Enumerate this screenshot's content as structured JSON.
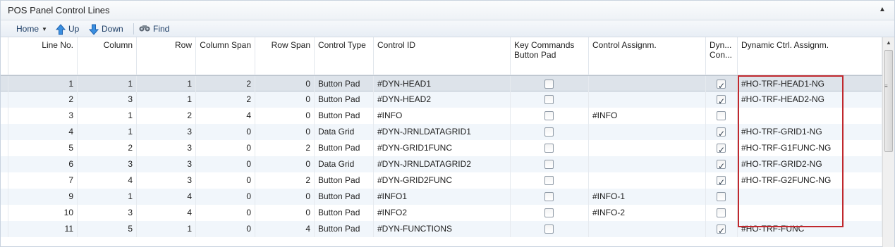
{
  "panel": {
    "title": "POS Panel Control Lines",
    "collapse_icon": "chevron-up-icon"
  },
  "toolbar": {
    "home_label": "Home",
    "up_label": "Up",
    "down_label": "Down",
    "find_label": "Find"
  },
  "columns": [
    {
      "label": "Line No.",
      "align": "right"
    },
    {
      "label": "Column",
      "align": "right"
    },
    {
      "label": "Row",
      "align": "right"
    },
    {
      "label": "Column Span",
      "align": "right"
    },
    {
      "label": "Row Span",
      "align": "right"
    },
    {
      "label": "Control Type",
      "align": "left"
    },
    {
      "label": "Control ID",
      "align": "left"
    },
    {
      "label": "Key Commands Button Pad",
      "align": "left"
    },
    {
      "label": "Control Assignm.",
      "align": "left"
    },
    {
      "label": "Dyn... Con...",
      "align": "left"
    },
    {
      "label": "Dynamic Ctrl. Assignm.",
      "align": "left"
    }
  ],
  "rows": [
    {
      "line": "1",
      "column": "1",
      "row": "1",
      "colspan": "2",
      "rowspan": "0",
      "type": "Button Pad",
      "id": "#DYN-HEAD1",
      "keycmd": false,
      "assign": "",
      "dyn": true,
      "dynassign": "#HO-TRF-HEAD1-NG"
    },
    {
      "line": "2",
      "column": "3",
      "row": "1",
      "colspan": "2",
      "rowspan": "0",
      "type": "Button Pad",
      "id": "#DYN-HEAD2",
      "keycmd": false,
      "assign": "",
      "dyn": true,
      "dynassign": "#HO-TRF-HEAD2-NG"
    },
    {
      "line": "3",
      "column": "1",
      "row": "2",
      "colspan": "4",
      "rowspan": "0",
      "type": "Button Pad",
      "id": "#INFO",
      "keycmd": false,
      "assign": "#INFO",
      "dyn": false,
      "dynassign": ""
    },
    {
      "line": "4",
      "column": "1",
      "row": "3",
      "colspan": "0",
      "rowspan": "0",
      "type": "Data Grid",
      "id": "#DYN-JRNLDATAGRID1",
      "keycmd": false,
      "assign": "",
      "dyn": true,
      "dynassign": "#HO-TRF-GRID1-NG"
    },
    {
      "line": "5",
      "column": "2",
      "row": "3",
      "colspan": "0",
      "rowspan": "2",
      "type": "Button Pad",
      "id": "#DYN-GRID1FUNC",
      "keycmd": false,
      "assign": "",
      "dyn": true,
      "dynassign": "#HO-TRF-G1FUNC-NG"
    },
    {
      "line": "6",
      "column": "3",
      "row": "3",
      "colspan": "0",
      "rowspan": "0",
      "type": "Data Grid",
      "id": "#DYN-JRNLDATAGRID2",
      "keycmd": false,
      "assign": "",
      "dyn": true,
      "dynassign": "#HO-TRF-GRID2-NG"
    },
    {
      "line": "7",
      "column": "4",
      "row": "3",
      "colspan": "0",
      "rowspan": "2",
      "type": "Button Pad",
      "id": "#DYN-GRID2FUNC",
      "keycmd": false,
      "assign": "",
      "dyn": true,
      "dynassign": "#HO-TRF-G2FUNC-NG"
    },
    {
      "line": "9",
      "column": "1",
      "row": "4",
      "colspan": "0",
      "rowspan": "0",
      "type": "Button Pad",
      "id": "#INFO1",
      "keycmd": false,
      "assign": "#INFO-1",
      "dyn": false,
      "dynassign": ""
    },
    {
      "line": "10",
      "column": "3",
      "row": "4",
      "colspan": "0",
      "rowspan": "0",
      "type": "Button Pad",
      "id": "#INFO2",
      "keycmd": false,
      "assign": "#INFO-2",
      "dyn": false,
      "dynassign": ""
    },
    {
      "line": "11",
      "column": "5",
      "row": "1",
      "colspan": "0",
      "rowspan": "4",
      "type": "Button Pad",
      "id": "#DYN-FUNCTIONS",
      "keycmd": false,
      "assign": "",
      "dyn": true,
      "dynassign": "#HO-TRF-FUNC"
    }
  ],
  "colors": {
    "highlight_border": "#c0282d",
    "alt_row": "#f1f6fb",
    "selected_row": "#dde3ea",
    "link_text": "#1e3e66"
  }
}
